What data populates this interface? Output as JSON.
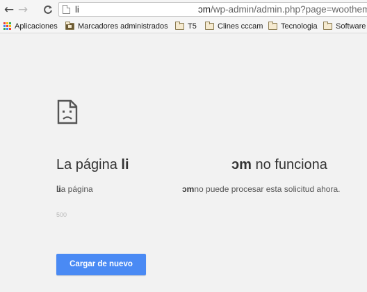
{
  "toolbar": {
    "url_prefix": "li",
    "url_domain_tail": "ɔm",
    "url_path": "/wp-admin/admin.php?page=woothemes"
  },
  "bookmarks": [
    {
      "label": "Aplicaciones",
      "icon": "apps-grid-icon"
    },
    {
      "label": "Marcadores administrados",
      "icon": "managed-folder-icon"
    },
    {
      "label": "T5",
      "icon": "folder-icon"
    },
    {
      "label": "Clines cccam",
      "icon": "folder-icon"
    },
    {
      "label": "Tecnologia",
      "icon": "folder-icon"
    },
    {
      "label": "Software",
      "icon": "folder-icon"
    }
  ],
  "error": {
    "heading_pre": "La página ",
    "heading_domain_start": "li",
    "heading_domain_end": "ɔm",
    "heading_post": " no funciona",
    "desc_pre": "La página ",
    "desc_domain_start": "li",
    "desc_domain_end": "ɔm",
    "desc_post": " no puede procesar esta solicitud ahora.",
    "code": "500",
    "reload_label": "Cargar de nuevo"
  },
  "colors": {
    "accent": "#4a8af4",
    "background": "#f2f2f2"
  }
}
